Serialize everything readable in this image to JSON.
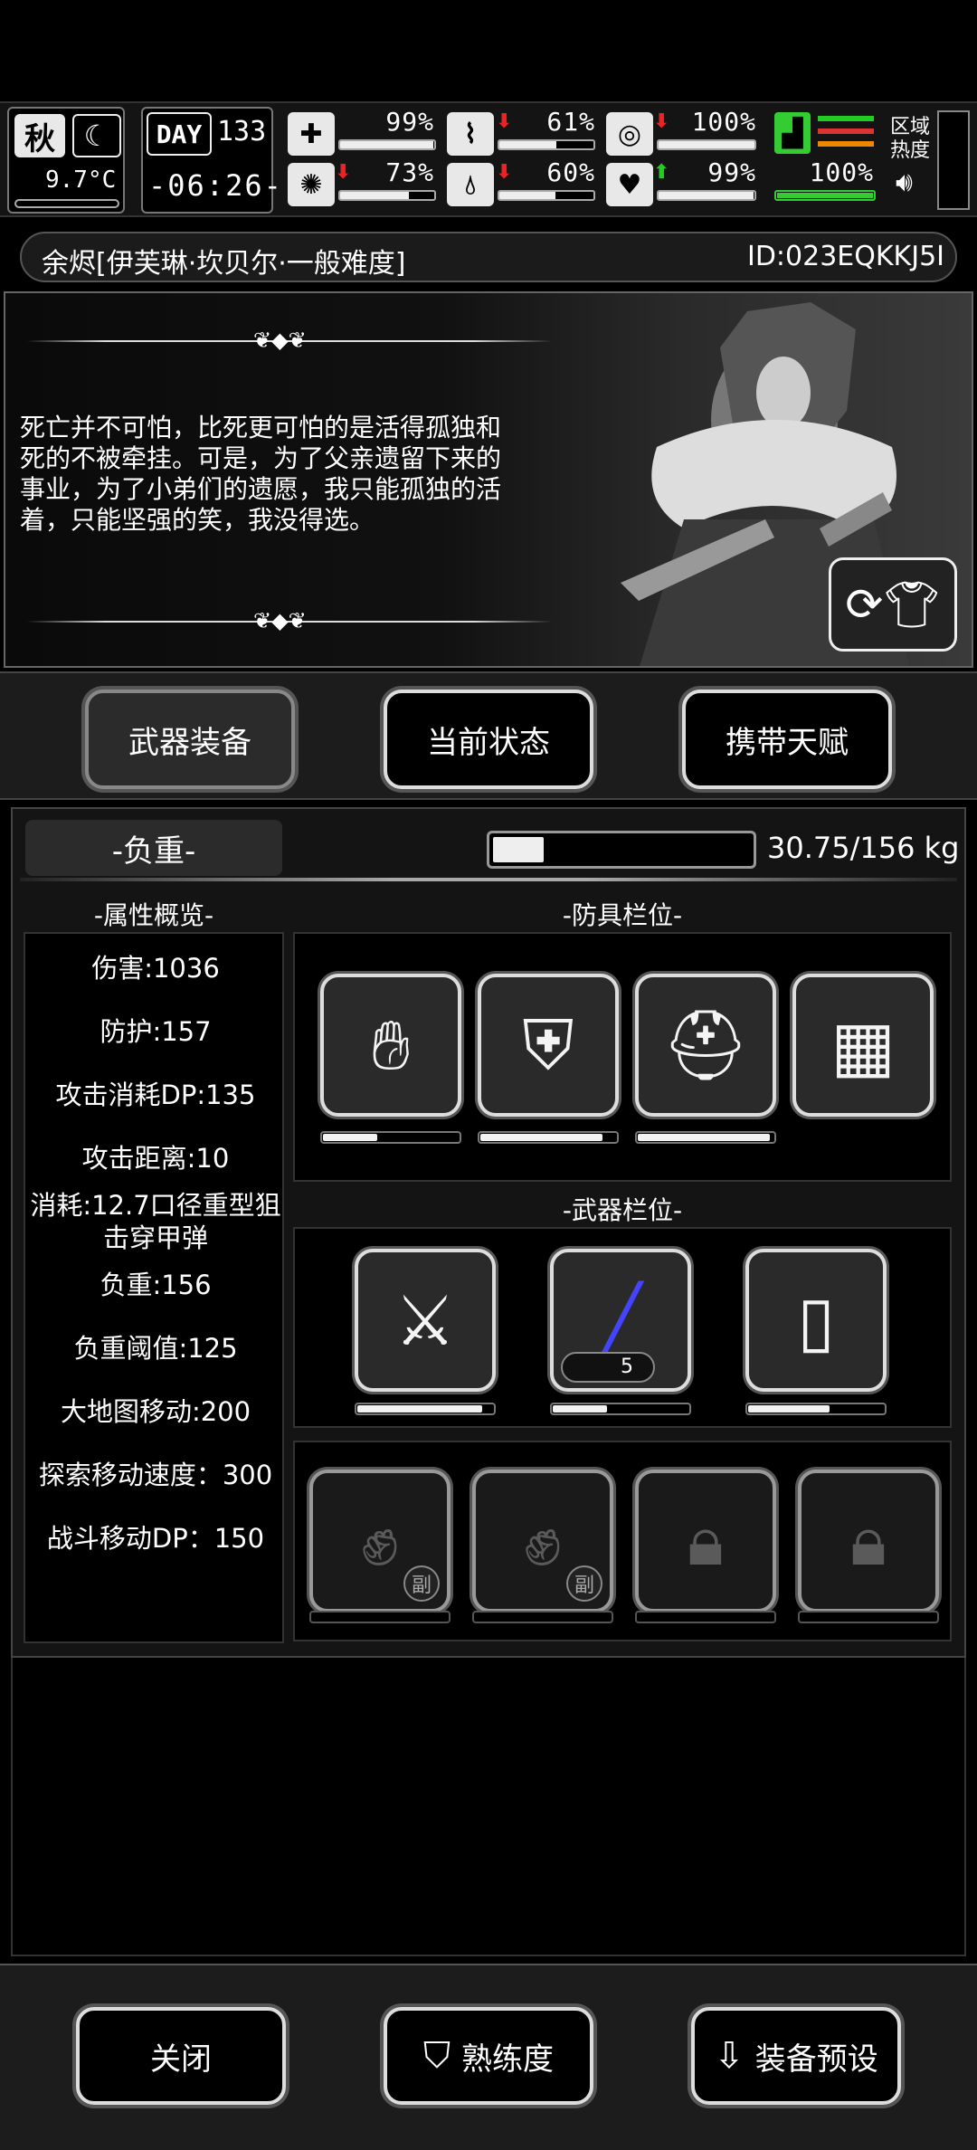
{
  "hud": {
    "season": "秋",
    "temperature": "9.7°C",
    "day_label": "DAY",
    "day_number": "133",
    "clock": "-06:26-",
    "stats": [
      {
        "id": "health",
        "icon": "first-aid-icon",
        "value": "99%",
        "level": 0.99,
        "trend": ""
      },
      {
        "id": "hunger",
        "icon": "stomach-icon",
        "value": "61%",
        "level": 0.61,
        "trend": "down"
      },
      {
        "id": "mood",
        "icon": "face-icon",
        "value": "100%",
        "level": 1.0,
        "trend": "down"
      },
      {
        "id": "sanity",
        "icon": "brain-icon",
        "value": "73%",
        "level": 0.73,
        "trend": "down"
      },
      {
        "id": "thirst",
        "icon": "water-drop-icon",
        "value": "60%",
        "level": 0.6,
        "trend": "down"
      },
      {
        "id": "heart",
        "icon": "heart-icon",
        "value": "99%",
        "level": 0.99,
        "trend": "up"
      }
    ],
    "stamina": {
      "value": "100%",
      "level": 1.0
    },
    "region_heat_label": "区域\n热度"
  },
  "character": {
    "name_bar": "余烬[伊芙琳·坎贝尔·一般难度]",
    "id": "ID:023EQKKJ5I",
    "quote": "死亡并不可怕，比死更可怕的是活得孤独和\n死的不被牵挂。可是，为了父亲遗留下来的\n事业，为了小弟们的遗愿，我只能孤独的活\n着，只能坚强的笑，我没得选。"
  },
  "tabs": [
    "武器装备",
    "当前状态",
    "携带天赋"
  ],
  "weight": {
    "label": "-负重-",
    "text": "30.75/156 kg",
    "level": 0.197
  },
  "sections": {
    "attrs": "-属性概览-",
    "armor": "-防具栏位-",
    "weapons": "-武器栏位-"
  },
  "attributes": [
    "伤害:1036",
    "防护:157",
    "攻击消耗DP:135",
    "攻击距离:10",
    "消耗:12.7口径重型狙\n击穿甲弹",
    "负重:156",
    "负重阈值:125",
    "大地图移动:200",
    "探索移动速度：300",
    "战斗移动DP：150"
  ],
  "armor_slots": [
    {
      "name": "gauntlet-icon",
      "durability": 0.4
    },
    {
      "name": "body-armor-icon",
      "durability": 0.9
    },
    {
      "name": "helmet-icon",
      "durability": 0.97
    },
    {
      "name": "backpack-icon",
      "durability": null
    }
  ],
  "weapon_slots": [
    {
      "name": "katana-icon",
      "durability": 0.92
    },
    {
      "name": "sniper-rifle-icon",
      "durability": 0.4,
      "ammo": "5"
    },
    {
      "name": "riot-shield-icon",
      "durability": 0.6
    }
  ],
  "sub_slots": [
    {
      "name": "fist-icon",
      "badge": "副"
    },
    {
      "name": "fist-icon",
      "badge": "副"
    },
    {
      "name": "lock-icon",
      "badge": ""
    },
    {
      "name": "lock-icon",
      "badge": ""
    }
  ],
  "bottom": {
    "close": "关闭",
    "proficiency": "熟练度",
    "preset": "装备预设"
  }
}
